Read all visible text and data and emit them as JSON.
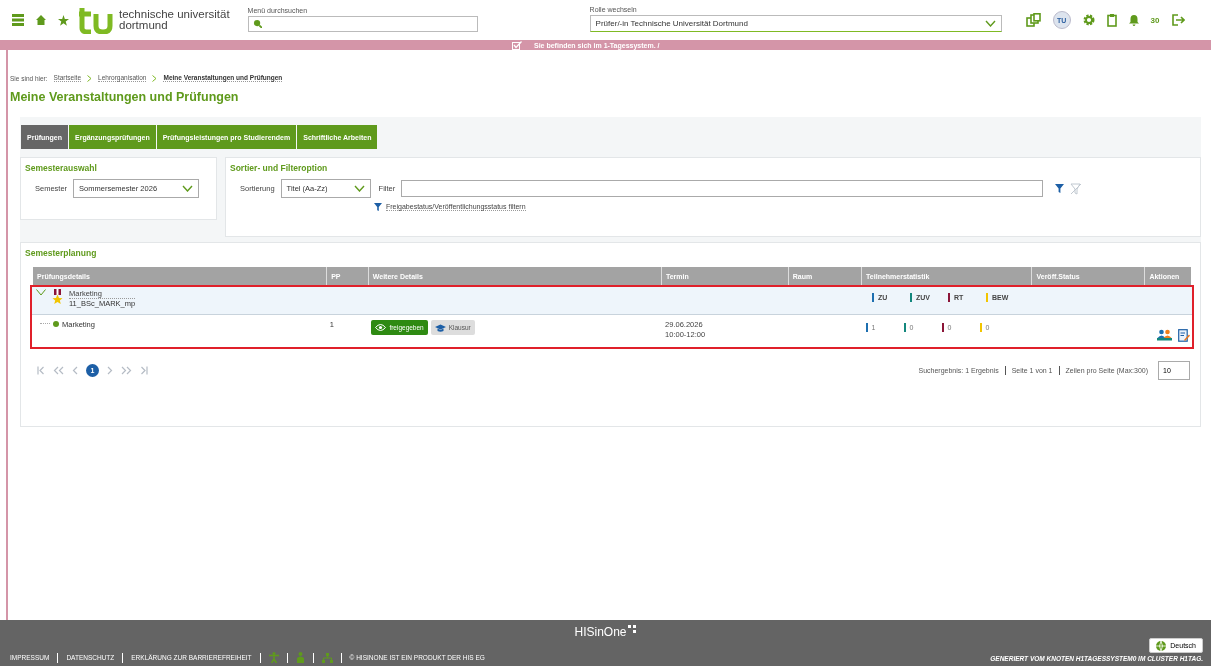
{
  "header": {
    "logo_line1": "technische universität",
    "logo_line2": "dortmund",
    "menu_search": {
      "label": "Menü durchsuchen"
    },
    "role": {
      "label": "Rolle wechseln",
      "value": "Prüfer/-in Technische Universität Dortmund"
    },
    "avatar": "TU",
    "notifications": "30"
  },
  "banner": {
    "text": "Sie befinden sich im 1-Tagessystem. /"
  },
  "breadcrumb": {
    "prefix": "Sie sind hier:",
    "items": [
      "Startseite",
      "Lehrorganisation",
      "Meine Veranstaltungen und Prüfungen"
    ]
  },
  "page_title": "Meine Veranstaltungen und Prüfungen",
  "tabs": [
    {
      "label": "Prüfungen",
      "selected": true
    },
    {
      "label": "Ergänzungsprüfungen",
      "selected": false
    },
    {
      "label": "Prüfungsleistungen pro Studierendem",
      "selected": false
    },
    {
      "label": "Schriftliche Arbeiten",
      "selected": false
    }
  ],
  "semester_box": {
    "title": "Semesterauswahl",
    "label": "Semester",
    "value": "Sommersemester 2026"
  },
  "filter_box": {
    "title": "Sortier- und Filteroption",
    "sort_label": "Sortierung",
    "sort_value": "Titel (Aa-Zz)",
    "filter_label": "Filter",
    "status_filter_link": "Freigabestatus/Veröffentlichungsstatus filtern"
  },
  "planning": {
    "title": "Semesterplanung",
    "columns": [
      "Prüfungsdetails",
      "PP",
      "Weitere Details",
      "Termin",
      "Raum",
      "Teilnehmerstatistik",
      "Veröff.Status",
      "Aktionen"
    ],
    "rows": [
      {
        "title": "Marketing",
        "code": "11_BSc_MARK_mp",
        "expanded": true,
        "stats": [
          {
            "label": "ZU",
            "color": "#1d6fb0"
          },
          {
            "label": "ZUV",
            "color": "#13877d"
          },
          {
            "label": "RT",
            "color": "#8b1538"
          },
          {
            "label": "BEW",
            "color": "#f2c500"
          }
        ],
        "children": [
          {
            "title": "Marketing",
            "pp": "1",
            "badges": [
              {
                "kind": "status",
                "label": "freigegeben"
              },
              {
                "kind": "type",
                "label": "Klausur"
              }
            ],
            "date": "29.06.2026",
            "time": "10:00-12:00",
            "stats": [
              {
                "value": "1",
                "color": "#1d6fb0"
              },
              {
                "value": "0",
                "color": "#13877d"
              },
              {
                "value": "0",
                "color": "#8b1538"
              },
              {
                "value": "0",
                "color": "#f2c500"
              }
            ]
          }
        ]
      }
    ]
  },
  "pagination": {
    "pages": [
      {
        "label": "1",
        "selected": true
      }
    ],
    "result": "Suchergebnis: 1 Ergebnis",
    "page_info": "Seite 1 von 1",
    "rows_label": "Zeilen pro Seite (Max:300)",
    "rows_value": "10"
  },
  "footer": {
    "links": [
      "IMPRESSUM",
      "DATENSCHUTZ",
      "ERKLÄRUNG ZUR BARRIEREFREIHEIT"
    ],
    "product": "© HISINONE IST EIN PRODUKT DER HIS EG",
    "brand": "HISinOne",
    "language": "Deutsch",
    "generated": "GENERIERT VOM KNOTEN H1TAGESSYSTEM0 IM CLUSTER H1TAG."
  }
}
